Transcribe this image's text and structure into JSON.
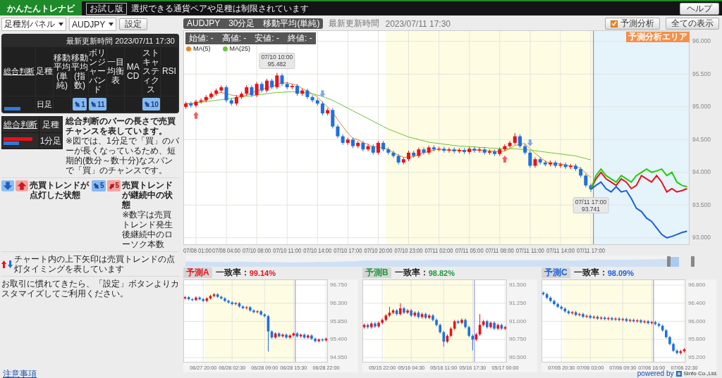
{
  "header": {
    "logo": "かんたんトレナビ",
    "trial_badge": "お試し版",
    "notice": "選択できる通貨ペアや足種は制限されています",
    "help_button": "ヘルプ"
  },
  "left_panel": {
    "panel_select": "足種別パネル",
    "pair_select": "AUDJPY",
    "settings_button": "設定",
    "summary_table": {
      "updated": "最新更新時間 2023/07/11 17:30",
      "columns": [
        "総合判断",
        "足種",
        "移動平均(単純)",
        "移動平均(指数)",
        "ボリンジャーバンド",
        "一目均衡表",
        "MACD",
        "ストキャスティクス",
        "RSI"
      ],
      "rows": [
        {
          "bars": [
            {
              "kind": "sell",
              "level": 0.55
            }
          ],
          "timeframe": "日足",
          "signals": [
            {
              "kind": "none"
            },
            {
              "kind": "down",
              "count": "1"
            },
            {
              "kind": "down",
              "count": "11"
            },
            {
              "kind": "none"
            },
            {
              "kind": "none"
            },
            {
              "kind": "down",
              "count": "10"
            },
            {
              "kind": "none"
            }
          ]
        }
      ]
    },
    "legend": {
      "columns": [
        "総合判断",
        "足種"
      ],
      "bars": [
        {
          "kind": "buy",
          "level": 0.85
        },
        {
          "kind": "sell",
          "level": 0.45
        }
      ],
      "timeframe": "1分足",
      "bar_note_title": "総合判断のバーの長さで売買チャンスを表しています。",
      "bar_note": "※図では、1分足で「買」のバーが長くなっているため、短期的(数分～数十分)なスパンで「買」のチャンスです。",
      "lit_icons": [
        {
          "kind": "down"
        },
        {
          "kind": "up"
        }
      ],
      "lit_label": "売買トレンドが点灯した状態",
      "continuing_badges": [
        {
          "kind": "down",
          "count": "5"
        },
        {
          "kind": "up",
          "count": "5"
        }
      ],
      "continuing_label": "売買トレンドが継続中の状態",
      "continuing_note": "※数字は売買トレンド発生後継続中のローソク本数",
      "arrow_note": "チャート内の上下矢印は売買トレンドの点灯タイミングを表しています",
      "custom_note": "お取引に慣れてきたら、「設定」ボタンよりカスタマイズしてご利用ください。"
    }
  },
  "main_chart": {
    "title": "AUDJPY　30分足　移動平均(単純)",
    "updated_label": "最新更新時間",
    "updated": "2023/07/11 17:30",
    "forecast_toggle": {
      "label": "予測分析",
      "checked": true
    },
    "show_all_button": "全ての表示",
    "forecast_area_label": "予測分析エリア",
    "ohlc": [
      "始値: -",
      "高値: -",
      "安値: -",
      "終値: -"
    ],
    "chart_data": {
      "type": "candlestick",
      "grid": true,
      "legend": "upper left",
      "ylim": [
        92.89,
        96.17
      ],
      "yticks": [
        {
          "value": 96,
          "label": "96.000"
        },
        {
          "value": 95.5,
          "label": "95.500"
        },
        {
          "value": 95,
          "label": "95.000"
        },
        {
          "value": 94.5,
          "label": "94.500"
        },
        {
          "value": 94,
          "label": "94.000"
        },
        {
          "value": 93.5,
          "label": "93.500"
        },
        {
          "value": 93,
          "label": "93.000"
        }
      ],
      "categories": [
        null,
        null,
        "07/08 01:00",
        null,
        null,
        null,
        null,
        null,
        "07/08 04:00",
        null,
        null,
        null,
        null,
        null,
        "07/10 08:00",
        null,
        null,
        null,
        null,
        null,
        "07/10 11:00",
        null,
        null,
        null,
        null,
        null,
        "07/10 14:00",
        null,
        null,
        null,
        null,
        null,
        "07/10 17:00",
        null,
        null,
        null,
        null,
        null,
        "07/10 20:00",
        null,
        null,
        null,
        null,
        null,
        "07/10 23:00",
        null,
        null,
        null,
        null,
        null,
        "07/11 02:00",
        null,
        null,
        null,
        null,
        null,
        "07/11 05:00",
        null,
        null,
        null,
        null,
        null,
        "07/11 08:00",
        null,
        null,
        null,
        null,
        null,
        "07/11 11:00",
        null,
        null,
        null,
        null,
        null,
        "07/11 14:00",
        null,
        null,
        null,
        null,
        null,
        "07/11 17:00",
        null,
        null,
        null,
        null,
        null,
        null,
        null,
        null,
        null,
        null,
        null,
        null,
        null,
        null,
        null,
        null,
        null,
        null,
        null
      ],
      "ohlc": [
        [
          95.0,
          95.08,
          94.97,
          95.05
        ],
        [
          95.05,
          95.08,
          94.99,
          95.02
        ],
        [
          95.02,
          95.11,
          94.99,
          95.08
        ],
        [
          95.08,
          95.13,
          95.05,
          95.1
        ],
        [
          95.1,
          95.18,
          95.07,
          95.15
        ],
        [
          95.15,
          95.23,
          95.12,
          95.2
        ],
        [
          95.2,
          95.28,
          95.17,
          95.25
        ],
        [
          95.25,
          95.33,
          95.22,
          95.3
        ],
        [
          95.3,
          95.33,
          95.07,
          95.1
        ],
        [
          95.1,
          95.13,
          95.02,
          95.05
        ],
        [
          95.05,
          95.18,
          95.02,
          95.15
        ],
        [
          95.15,
          95.23,
          95.12,
          95.2
        ],
        [
          95.2,
          95.33,
          95.17,
          95.3
        ],
        [
          95.3,
          95.33,
          95.15,
          95.18
        ],
        [
          95.18,
          95.38,
          95.15,
          95.35
        ],
        [
          95.35,
          95.38,
          95.22,
          95.25
        ],
        [
          95.25,
          95.43,
          95.22,
          95.4
        ],
        [
          95.4,
          95.43,
          95.27,
          95.3
        ],
        [
          95.3,
          95.52,
          95.27,
          95.48
        ],
        [
          95.48,
          95.51,
          95.32,
          95.35
        ],
        [
          95.35,
          95.38,
          95.27,
          95.3
        ],
        [
          95.3,
          95.35,
          95.27,
          95.32
        ],
        [
          95.32,
          95.35,
          95.17,
          95.2
        ],
        [
          95.2,
          95.28,
          95.17,
          95.25
        ],
        [
          95.25,
          95.28,
          95.12,
          95.15
        ],
        [
          95.15,
          95.18,
          95.07,
          95.1
        ],
        [
          95.1,
          95.13,
          95.02,
          95.05
        ],
        [
          95.05,
          95.08,
          94.87,
          94.9
        ],
        [
          94.9,
          94.98,
          94.87,
          94.95
        ],
        [
          94.95,
          94.98,
          94.67,
          94.7
        ],
        [
          94.7,
          94.73,
          94.52,
          94.55
        ],
        [
          94.55,
          94.58,
          94.42,
          94.45
        ],
        [
          94.45,
          94.53,
          94.42,
          94.5
        ],
        [
          94.5,
          94.53,
          94.37,
          94.4
        ],
        [
          94.4,
          94.48,
          94.37,
          94.45
        ],
        [
          94.45,
          94.48,
          94.32,
          94.35
        ],
        [
          94.35,
          94.43,
          94.32,
          94.4
        ],
        [
          94.4,
          94.43,
          94.27,
          94.3
        ],
        [
          94.3,
          94.48,
          94.27,
          94.45
        ],
        [
          94.45,
          94.48,
          94.32,
          94.35
        ],
        [
          94.35,
          94.38,
          94.27,
          94.3
        ],
        [
          94.3,
          94.33,
          94.22,
          94.25
        ],
        [
          94.25,
          94.28,
          94.12,
          94.15
        ],
        [
          94.15,
          94.23,
          94.12,
          94.2
        ],
        [
          94.2,
          94.33,
          94.17,
          94.3
        ],
        [
          94.3,
          94.33,
          94.22,
          94.25
        ],
        [
          94.25,
          94.38,
          94.22,
          94.35
        ],
        [
          94.35,
          94.38,
          94.27,
          94.3
        ],
        [
          94.3,
          94.41,
          94.27,
          94.38
        ],
        [
          94.38,
          94.41,
          94.32,
          94.35
        ],
        [
          94.35,
          94.39,
          94.32,
          94.36
        ],
        [
          94.36,
          94.39,
          94.3,
          94.33
        ],
        [
          94.33,
          94.38,
          94.3,
          94.35
        ],
        [
          94.35,
          94.38,
          94.29,
          94.32
        ],
        [
          94.32,
          94.37,
          94.29,
          94.34
        ],
        [
          94.34,
          94.37,
          94.28,
          94.31
        ],
        [
          94.31,
          94.39,
          94.28,
          94.36
        ],
        [
          94.36,
          94.39,
          94.3,
          94.33
        ],
        [
          94.33,
          94.38,
          94.3,
          94.35
        ],
        [
          94.35,
          94.38,
          94.27,
          94.3
        ],
        [
          94.3,
          94.35,
          94.27,
          94.32
        ],
        [
          94.32,
          94.35,
          94.25,
          94.28
        ],
        [
          94.28,
          94.38,
          94.25,
          94.35
        ],
        [
          94.35,
          94.43,
          94.32,
          94.4
        ],
        [
          94.4,
          94.48,
          94.37,
          94.45
        ],
        [
          94.45,
          94.6,
          94.42,
          94.55
        ],
        [
          94.55,
          94.58,
          94.37,
          94.4
        ],
        [
          94.4,
          94.43,
          94.27,
          94.3
        ],
        [
          94.3,
          94.33,
          94.07,
          94.1
        ],
        [
          94.1,
          94.23,
          94.07,
          94.2
        ],
        [
          94.2,
          94.23,
          94.12,
          94.15
        ],
        [
          94.15,
          94.18,
          94.09,
          94.12
        ],
        [
          94.12,
          94.18,
          94.09,
          94.15
        ],
        [
          94.15,
          94.18,
          94.07,
          94.1
        ],
        [
          94.1,
          94.15,
          94.07,
          94.12
        ],
        [
          94.12,
          94.15,
          94.05,
          94.08
        ],
        [
          94.08,
          94.13,
          94.05,
          94.1
        ],
        [
          94.1,
          94.13,
          94.02,
          94.05
        ],
        [
          94.05,
          94.08,
          93.92,
          93.95
        ],
        [
          93.95,
          93.98,
          93.77,
          93.8
        ],
        [
          93.8,
          93.83,
          93.7,
          93.74
        ],
        null,
        null,
        null,
        null,
        null,
        null,
        null,
        null,
        null,
        null,
        null,
        null,
        null,
        null,
        null,
        null,
        null,
        null,
        null
      ],
      "series": [
        {
          "name": "MA(5)",
          "type": "line",
          "color": "#f0801e",
          "values": [
            95.05,
            95.05,
            95.06,
            95.08,
            95.1,
            95.15,
            95.2,
            95.22,
            95.2,
            95.18,
            95.17,
            95.16,
            95.18,
            95.21,
            95.25,
            95.26,
            95.3,
            95.3,
            95.35,
            95.36,
            95.37,
            95.35,
            95.33,
            95.28,
            95.24,
            95.2,
            95.15,
            95.07,
            95.0,
            94.92,
            94.8,
            94.7,
            94.6,
            94.52,
            94.5,
            94.45,
            94.43,
            94.38,
            94.39,
            94.37,
            94.35,
            94.3,
            94.26,
            94.23,
            94.23,
            94.24,
            94.27,
            94.3,
            94.32,
            94.34,
            94.35,
            94.34,
            94.34,
            94.34,
            94.34,
            94.33,
            94.34,
            94.34,
            94.34,
            94.33,
            94.33,
            94.32,
            94.31,
            94.33,
            94.36,
            94.41,
            94.43,
            94.44,
            94.36,
            94.29,
            94.23,
            94.17,
            94.14,
            94.14,
            94.13,
            94.11,
            94.1,
            94.09,
            94.06,
            93.99,
            93.92,
            null,
            null,
            null,
            null,
            null,
            null,
            null,
            null,
            null,
            null,
            null,
            null,
            null,
            null,
            null,
            null,
            null,
            null,
            null
          ]
        },
        {
          "name": "MA(25)",
          "type": "line",
          "color": "#6cc23a",
          "values": [
            95.05,
            95.05,
            95.06,
            95.07,
            95.08,
            95.09,
            95.1,
            95.11,
            95.12,
            95.13,
            95.14,
            95.15,
            95.16,
            95.17,
            95.18,
            95.19,
            95.2,
            95.21,
            95.22,
            95.22,
            95.23,
            95.23,
            95.23,
            95.22,
            95.21,
            95.2,
            95.18,
            95.16,
            95.13,
            95.1,
            95.06,
            95.02,
            94.98,
            94.94,
            94.9,
            94.86,
            94.82,
            94.78,
            94.74,
            94.7,
            94.66,
            94.63,
            94.6,
            94.57,
            94.54,
            94.52,
            94.5,
            94.48,
            94.46,
            94.45,
            94.44,
            94.43,
            94.42,
            94.41,
            94.4,
            94.4,
            94.39,
            94.39,
            94.38,
            94.38,
            94.37,
            94.37,
            94.36,
            94.36,
            94.36,
            94.36,
            94.35,
            94.35,
            94.34,
            94.33,
            94.32,
            94.31,
            94.3,
            94.29,
            94.28,
            94.27,
            94.26,
            94.25,
            94.23,
            94.21,
            94.19,
            null,
            null,
            null,
            null,
            null,
            null,
            null,
            null,
            null,
            null,
            null,
            null,
            null,
            null,
            null,
            null,
            null,
            null,
            null
          ]
        },
        {
          "type": "line",
          "color": "#e8121b",
          "values": [
            null,
            null,
            null,
            null,
            null,
            null,
            null,
            null,
            null,
            null,
            null,
            null,
            null,
            null,
            null,
            null,
            null,
            null,
            null,
            null,
            null,
            null,
            null,
            null,
            null,
            null,
            null,
            null,
            null,
            null,
            null,
            null,
            null,
            null,
            null,
            null,
            null,
            null,
            null,
            null,
            null,
            null,
            null,
            null,
            null,
            null,
            null,
            null,
            null,
            null,
            null,
            null,
            null,
            null,
            null,
            null,
            null,
            null,
            null,
            null,
            null,
            null,
            null,
            null,
            null,
            null,
            null,
            null,
            null,
            null,
            null,
            null,
            null,
            null,
            null,
            null,
            null,
            null,
            null,
            null,
            93.74,
            93.9,
            94.0,
            93.9,
            93.85,
            93.8,
            93.9,
            93.85,
            93.75,
            93.8,
            93.95,
            93.9,
            93.85,
            93.95,
            93.85,
            93.7,
            93.75,
            93.7,
            93.72,
            93.75
          ]
        },
        {
          "type": "line",
          "color": "#22cc11",
          "values": [
            null,
            null,
            null,
            null,
            null,
            null,
            null,
            null,
            null,
            null,
            null,
            null,
            null,
            null,
            null,
            null,
            null,
            null,
            null,
            null,
            null,
            null,
            null,
            null,
            null,
            null,
            null,
            null,
            null,
            null,
            null,
            null,
            null,
            null,
            null,
            null,
            null,
            null,
            null,
            null,
            null,
            null,
            null,
            null,
            null,
            null,
            null,
            null,
            null,
            null,
            null,
            null,
            null,
            null,
            null,
            null,
            null,
            null,
            null,
            null,
            null,
            null,
            null,
            null,
            null,
            null,
            null,
            null,
            null,
            null,
            null,
            null,
            null,
            null,
            null,
            null,
            null,
            null,
            null,
            null,
            93.74,
            93.95,
            94.05,
            93.95,
            93.9,
            93.85,
            93.95,
            93.9,
            93.85,
            93.95,
            94.0,
            94.05,
            94.0,
            94.02,
            94.05,
            93.95,
            94.0,
            93.85,
            93.8,
            93.78
          ]
        },
        {
          "type": "line",
          "color": "#1a5fe0",
          "values": [
            null,
            null,
            null,
            null,
            null,
            null,
            null,
            null,
            null,
            null,
            null,
            null,
            null,
            null,
            null,
            null,
            null,
            null,
            null,
            null,
            null,
            null,
            null,
            null,
            null,
            null,
            null,
            null,
            null,
            null,
            null,
            null,
            null,
            null,
            null,
            null,
            null,
            null,
            null,
            null,
            null,
            null,
            null,
            null,
            null,
            null,
            null,
            null,
            null,
            null,
            null,
            null,
            null,
            null,
            null,
            null,
            null,
            null,
            null,
            null,
            null,
            null,
            null,
            null,
            null,
            null,
            null,
            null,
            null,
            null,
            null,
            null,
            null,
            null,
            null,
            null,
            null,
            null,
            null,
            null,
            93.74,
            93.8,
            93.85,
            93.75,
            93.7,
            93.78,
            93.7,
            93.72,
            93.6,
            93.45,
            93.4,
            93.3,
            93.25,
            93.15,
            93.05,
            93.0,
            93.02,
            93.05,
            93.08,
            93.1
          ]
        }
      ],
      "annotations": [
        "07/10 10:00\n95.482",
        "07/11 17:00\n93.741"
      ]
    }
  },
  "forecast_panels": [
    {
      "tab": "予測A",
      "color": "#e8121b",
      "match_label": "一致率：",
      "match_value": "99.14%",
      "chart_data": {
        "type": "candlestick",
        "grid": true,
        "ylim": [
          94.83,
          96.89
        ],
        "yticks": [
          {
            "value": 96.75,
            "label": "96.750"
          },
          {
            "value": 96.3,
            "label": "96.300"
          },
          {
            "value": 95.85,
            "label": "95.850"
          },
          {
            "value": 95.4,
            "label": "95.400"
          },
          {
            "value": 94.95,
            "label": "94.950"
          }
        ],
        "categories": [
          null,
          null,
          null,
          null,
          null,
          "06/27 20:00",
          null,
          null,
          null,
          null,
          null,
          null,
          null,
          "06/28 02:30",
          null,
          null,
          null,
          null,
          null,
          null,
          null,
          null,
          "06/28 09:00",
          null,
          null,
          null,
          null,
          null,
          null,
          null,
          "06/28 15:30",
          null,
          null,
          null,
          null,
          null,
          null,
          null,
          null,
          "06/28 22:00"
        ],
        "ohlc": [
          [
            96.42,
            96.48,
            96.39,
            96.45
          ],
          [
            96.45,
            96.48,
            96.37,
            96.4
          ],
          [
            96.4,
            96.43,
            96.35,
            96.38
          ],
          [
            96.38,
            96.47,
            96.35,
            96.44
          ],
          [
            96.44,
            96.47,
            96.37,
            96.4
          ],
          [
            96.4,
            96.43,
            96.33,
            96.36
          ],
          [
            96.36,
            96.45,
            96.33,
            96.42
          ],
          [
            96.42,
            96.51,
            96.39,
            96.48
          ],
          [
            96.48,
            96.55,
            96.45,
            96.52
          ],
          [
            96.52,
            96.55,
            96.43,
            96.46
          ],
          [
            96.46,
            96.49,
            96.39,
            96.42
          ],
          [
            96.42,
            96.45,
            96.33,
            96.36
          ],
          [
            96.36,
            96.39,
            96.29,
            96.32
          ],
          [
            96.32,
            96.35,
            96.25,
            96.28
          ],
          [
            96.28,
            96.33,
            96.25,
            96.3
          ],
          [
            96.3,
            96.33,
            96.19,
            96.22
          ],
          [
            96.22,
            96.25,
            96.15,
            96.18
          ],
          [
            96.18,
            96.23,
            96.15,
            96.2
          ],
          [
            96.2,
            96.23,
            96.09,
            96.12
          ],
          [
            96.12,
            96.15,
            96.05,
            96.08
          ],
          [
            96.08,
            96.13,
            96.05,
            96.1
          ],
          [
            96.1,
            96.13,
            95.99,
            96.02
          ],
          [
            96.02,
            96.05,
            95.95,
            95.98
          ],
          [
            95.98,
            96.01,
            95.1,
            95.6
          ],
          [
            95.6,
            95.63,
            95.42,
            95.45
          ],
          [
            95.45,
            95.58,
            95.42,
            95.55
          ],
          [
            95.55,
            95.58,
            95.45,
            95.48
          ],
          [
            95.48,
            95.55,
            95.45,
            95.52
          ],
          [
            95.52,
            95.55,
            95.42,
            95.45
          ],
          [
            95.45,
            95.53,
            95.42,
            95.5
          ],
          [
            95.5,
            95.58,
            95.47,
            95.55
          ],
          [
            95.55,
            95.58,
            95.45,
            95.48
          ],
          [
            95.48,
            95.55,
            95.45,
            95.52
          ],
          [
            95.52,
            95.55,
            95.42,
            95.45
          ],
          [
            95.45,
            95.53,
            95.42,
            95.5
          ],
          [
            95.5,
            95.53,
            95.39,
            95.42
          ],
          [
            95.42,
            95.45,
            95.33,
            95.36
          ],
          [
            95.36,
            95.43,
            95.33,
            95.4
          ],
          [
            95.4,
            95.43,
            95.35,
            95.38
          ],
          [
            95.38,
            95.45,
            95.35,
            95.42
          ]
        ]
      }
    },
    {
      "tab": "予測B",
      "color": "#1f9a3a",
      "match_label": "一致率：",
      "match_value": "98.82%",
      "chart_data": {
        "type": "candlestick",
        "grid": true,
        "ylim": [
          90.432,
          91.578
        ],
        "yticks": [
          {
            "value": 91.5,
            "label": "91.500"
          },
          {
            "value": 91.25,
            "label": "91.250"
          },
          {
            "value": 91,
            "label": "91.000"
          },
          {
            "value": 90.75,
            "label": "90.750"
          },
          {
            "value": 90.5,
            "label": "90.500"
          }
        ],
        "categories": [
          null,
          null,
          null,
          null,
          null,
          "05/15 22:00",
          null,
          null,
          null,
          null,
          null,
          null,
          null,
          "05/16 04:30",
          null,
          null,
          null,
          null,
          null,
          null,
          null,
          null,
          "05/16 11:00",
          null,
          null,
          null,
          null,
          null,
          null,
          null,
          "05/16 17:30",
          null,
          null,
          null,
          null,
          null,
          null,
          null,
          null,
          "05/17 00:00"
        ],
        "ohlc": [
          [
            90.92,
            90.97,
            90.9,
            90.95
          ],
          [
            90.95,
            90.97,
            90.9,
            90.92
          ],
          [
            90.92,
            90.99,
            90.9,
            90.97
          ],
          [
            90.97,
            90.99,
            90.91,
            90.93
          ],
          [
            90.93,
            91.0,
            90.91,
            90.98
          ],
          [
            90.98,
            91.04,
            90.96,
            91.02
          ],
          [
            91.02,
            91.1,
            91.0,
            91.08
          ],
          [
            91.08,
            91.2,
            91.06,
            91.12
          ],
          [
            91.12,
            91.17,
            91.1,
            91.15
          ],
          [
            91.15,
            91.17,
            91.08,
            91.1
          ],
          [
            91.1,
            91.25,
            91.08,
            91.18
          ],
          [
            91.18,
            91.2,
            91.1,
            91.12
          ],
          [
            91.12,
            91.17,
            91.1,
            91.15
          ],
          [
            91.15,
            91.17,
            91.06,
            91.08
          ],
          [
            91.08,
            91.14,
            91.06,
            91.12
          ],
          [
            91.12,
            91.14,
            91.04,
            91.06
          ],
          [
            91.06,
            91.12,
            91.04,
            91.1
          ],
          [
            91.1,
            91.12,
            91.03,
            91.05
          ],
          [
            91.05,
            91.1,
            91.03,
            91.08
          ],
          [
            91.08,
            91.1,
            91.0,
            91.02
          ],
          [
            91.02,
            91.04,
            90.93,
            90.95
          ],
          [
            90.95,
            90.97,
            90.83,
            90.85
          ],
          [
            90.85,
            90.87,
            90.65,
            90.72
          ],
          [
            90.72,
            90.82,
            90.7,
            90.8
          ],
          [
            90.8,
            90.92,
            90.78,
            90.9
          ],
          [
            90.9,
            91.02,
            90.88,
            91.0
          ],
          [
            91.0,
            91.02,
            90.96,
            90.98
          ],
          [
            90.98,
            91.04,
            90.96,
            91.02
          ],
          [
            91.02,
            91.04,
            90.9,
            90.92
          ],
          [
            90.92,
            90.94,
            90.78,
            90.8
          ],
          [
            90.8,
            90.82,
            90.6,
            90.75
          ],
          [
            90.75,
            90.84,
            90.73,
            90.82
          ],
          [
            90.82,
            91.1,
            90.8,
            90.95
          ],
          [
            90.95,
            91.02,
            90.93,
            91.0
          ],
          [
            91.0,
            91.02,
            90.9,
            90.92
          ],
          [
            90.92,
            91.0,
            90.9,
            90.98
          ],
          [
            90.98,
            91.0,
            90.88,
            90.9
          ],
          [
            90.9,
            90.97,
            90.88,
            90.95
          ],
          [
            90.95,
            90.97,
            90.88,
            90.9
          ],
          [
            90.9,
            90.94,
            90.88,
            90.92
          ]
        ]
      }
    },
    {
      "tab": "予測C",
      "color": "#1a5fe0",
      "match_label": "一致率：",
      "match_value": "98.09%",
      "chart_data": {
        "type": "candlestick",
        "grid": true,
        "ylim": [
          95.09,
          96.924
        ],
        "yticks": [
          {
            "value": 96.8,
            "label": "96.800"
          },
          {
            "value": 96.4,
            "label": "96.400"
          },
          {
            "value": 96,
            "label": "96.000"
          },
          {
            "value": 95.6,
            "label": "95.600"
          },
          {
            "value": 95.2,
            "label": "95.200"
          }
        ],
        "categories": [
          null,
          null,
          null,
          null,
          null,
          "07/05 20:30",
          null,
          null,
          null,
          null,
          null,
          null,
          null,
          "07/06 03:00",
          null,
          null,
          null,
          null,
          null,
          null,
          null,
          null,
          "07/06 09:30",
          null,
          null,
          null,
          null,
          null,
          null,
          null,
          "07/06 16:00",
          null,
          null,
          null,
          null,
          null,
          null,
          null,
          null,
          "07/06 22:30"
        ],
        "ohlc": [
          [
            96.63,
            96.66,
            96.57,
            96.6
          ],
          [
            96.6,
            96.63,
            96.49,
            96.52
          ],
          [
            96.52,
            96.55,
            96.42,
            96.45
          ],
          [
            96.45,
            96.48,
            96.35,
            96.38
          ],
          [
            96.38,
            96.41,
            96.29,
            96.32
          ],
          [
            96.32,
            96.35,
            96.25,
            96.28
          ],
          [
            96.28,
            96.31,
            96.19,
            96.22
          ],
          [
            96.22,
            96.25,
            96.15,
            96.18
          ],
          [
            96.18,
            96.23,
            96.15,
            96.2
          ],
          [
            96.2,
            96.23,
            96.11,
            96.14
          ],
          [
            96.14,
            96.19,
            96.11,
            96.16
          ],
          [
            96.16,
            96.19,
            96.07,
            96.1
          ],
          [
            96.1,
            96.15,
            96.07,
            96.12
          ],
          [
            96.12,
            96.15,
            96.05,
            96.08
          ],
          [
            96.08,
            96.13,
            96.05,
            96.1
          ],
          [
            96.1,
            96.13,
            96.03,
            96.06
          ],
          [
            96.06,
            96.11,
            96.03,
            96.08
          ],
          [
            96.08,
            96.11,
            96.02,
            96.05
          ],
          [
            96.05,
            96.1,
            96.02,
            96.07
          ],
          [
            96.07,
            96.1,
            96.01,
            96.04
          ],
          [
            96.04,
            96.09,
            96.01,
            96.06
          ],
          [
            96.06,
            96.09,
            96.0,
            96.03
          ],
          [
            96.03,
            96.08,
            96.0,
            96.05
          ],
          [
            96.05,
            96.08,
            95.98,
            96.01
          ],
          [
            96.01,
            96.06,
            95.98,
            96.03
          ],
          [
            96.03,
            96.06,
            95.97,
            96.0
          ],
          [
            96.0,
            96.05,
            95.97,
            96.02
          ],
          [
            96.02,
            96.05,
            95.95,
            95.98
          ],
          [
            95.98,
            96.03,
            95.95,
            96.0
          ],
          [
            96.0,
            96.03,
            95.93,
            95.96
          ],
          [
            95.96,
            96.01,
            95.93,
            95.98
          ],
          [
            95.98,
            96.01,
            95.91,
            95.94
          ],
          [
            95.94,
            95.97,
            95.87,
            95.9
          ],
          [
            95.9,
            95.93,
            95.77,
            95.8
          ],
          [
            95.8,
            95.83,
            95.62,
            95.65
          ],
          [
            95.65,
            95.68,
            95.47,
            95.5
          ],
          [
            95.5,
            95.53,
            95.32,
            95.35
          ],
          [
            95.35,
            95.38,
            95.27,
            95.3
          ],
          [
            95.3,
            95.37,
            95.27,
            95.34
          ],
          [
            95.34,
            95.41,
            95.31,
            95.38
          ]
        ]
      }
    }
  ],
  "footer": {
    "notice_link": "注意事項",
    "powered_by": "powered by",
    "company": "Sinfo Co.,Ltd."
  }
}
